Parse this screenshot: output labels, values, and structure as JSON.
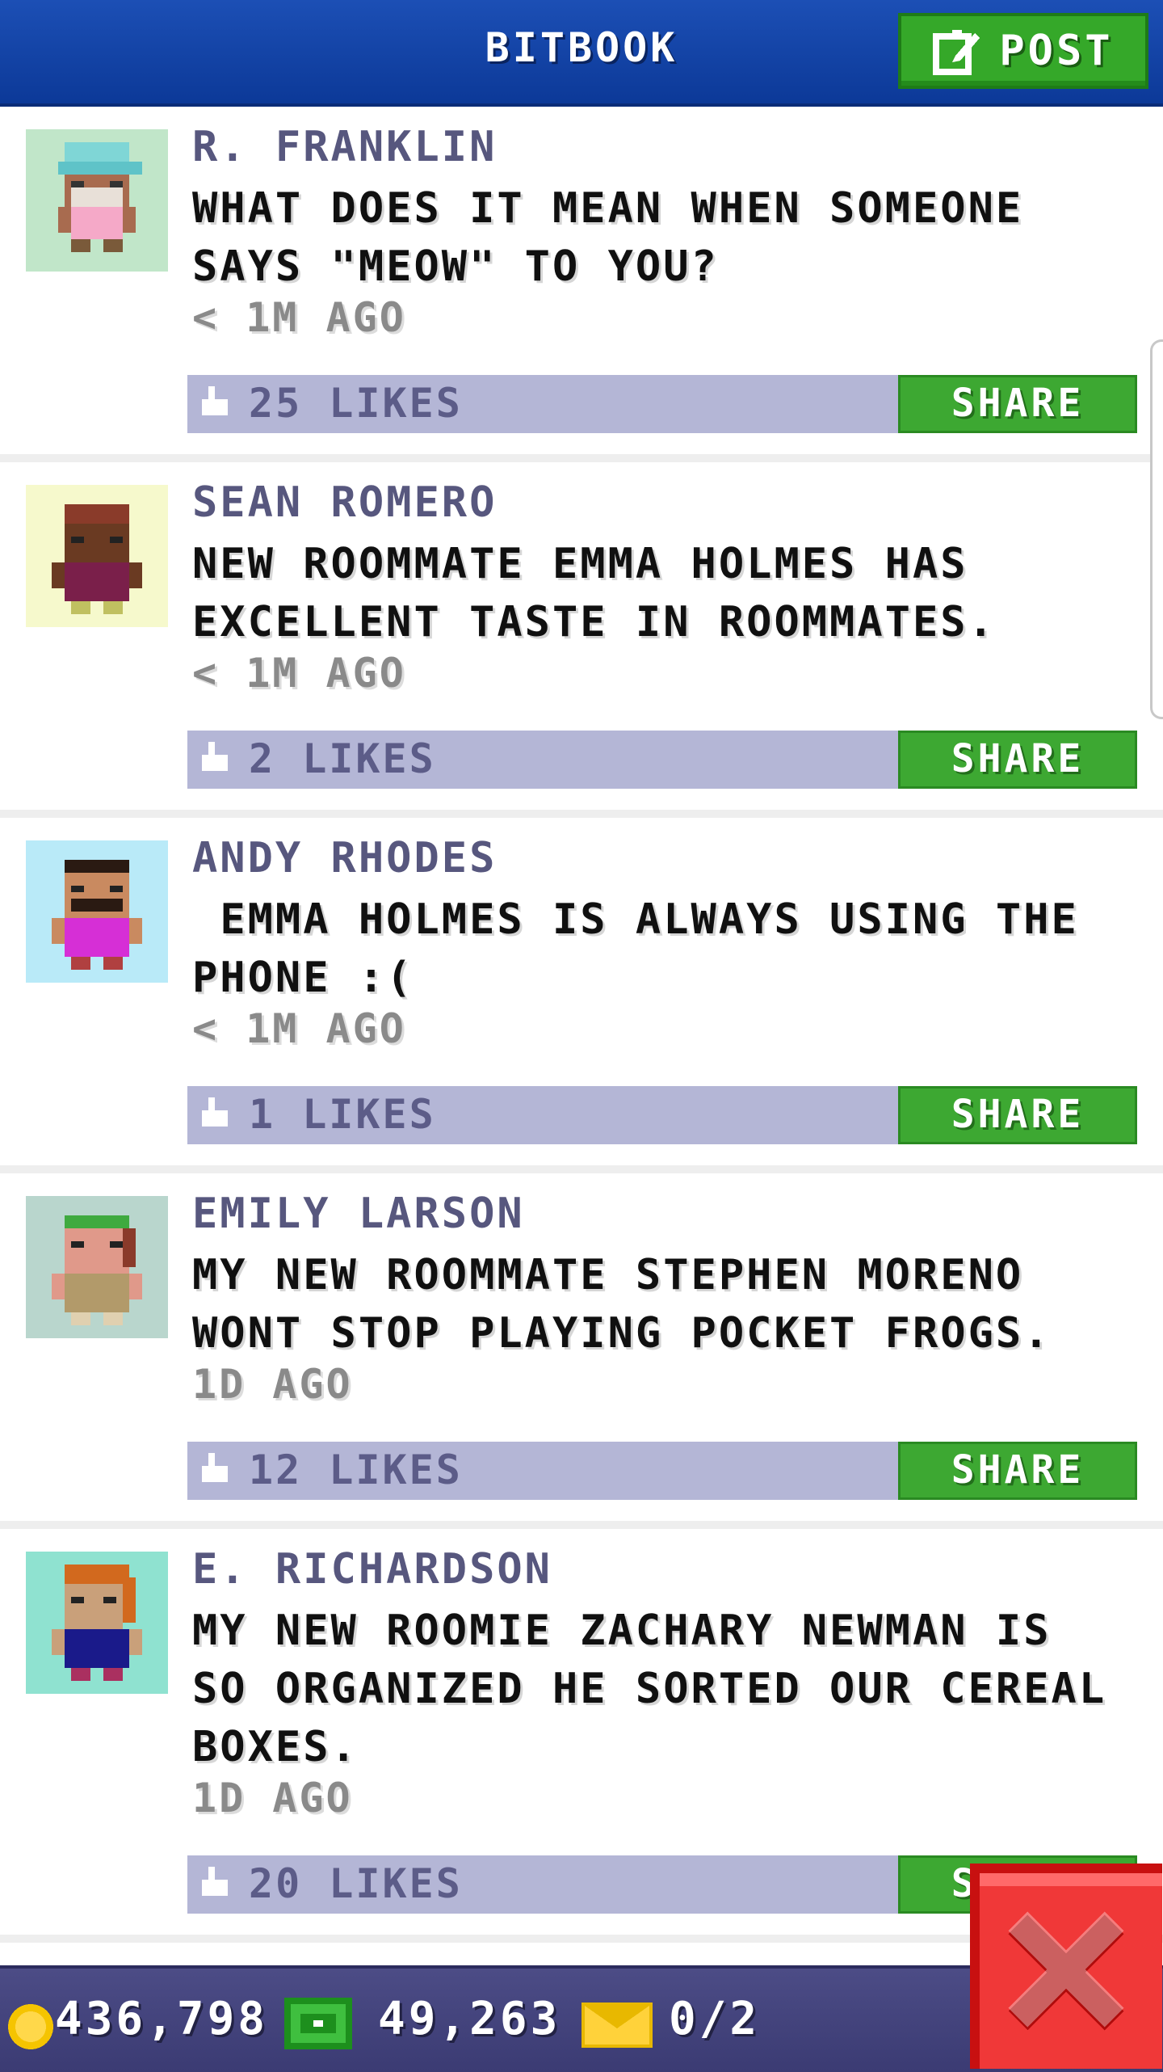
{
  "header": {
    "title": "BITBOOK",
    "post_label": "POST"
  },
  "posts": [
    {
      "author": "R. FRANKLIN",
      "text": "WHAT DOES IT MEAN WHEN SOMEONE\nSAYS \"MEOW\" TO YOU?",
      "time": "< 1M AGO",
      "likes": "25 LIKES",
      "share": "SHARE",
      "avatar_bg": "#c1e6c9"
    },
    {
      "author": "SEAN ROMERO",
      "text": "NEW ROOMMATE EMMA HOLMES HAS\nEXCELLENT TASTE IN ROOMMATES.",
      "time": "< 1M AGO",
      "likes": "2 LIKES",
      "share": "SHARE",
      "avatar_bg": "#f6f9cc"
    },
    {
      "author": "ANDY RHODES",
      "text": " EMMA HOLMES IS ALWAYS USING THE\nPHONE :(",
      "time": "< 1M AGO",
      "likes": "1 LIKES",
      "share": "SHARE",
      "avatar_bg": "#b9eaf8"
    },
    {
      "author": "EMILY LARSON",
      "text": "MY NEW ROOMMATE STEPHEN MORENO\nWONT STOP PLAYING POCKET FROGS.",
      "time": "1D AGO",
      "likes": "12 LIKES",
      "share": "SHARE",
      "avatar_bg": "#b9d6cd"
    },
    {
      "author": "E. RICHARDSON",
      "text": "MY NEW ROOMIE ZACHARY NEWMAN IS\nSO ORGANIZED HE SORTED OUR CEREAL\nBOXES.",
      "time": "1D AGO",
      "likes": "20 LIKES",
      "share": "SHARE",
      "avatar_bg": "#8fe2d0"
    }
  ],
  "footer": {
    "coins": "436,798",
    "bux": "49,263",
    "mail": "0/2"
  }
}
